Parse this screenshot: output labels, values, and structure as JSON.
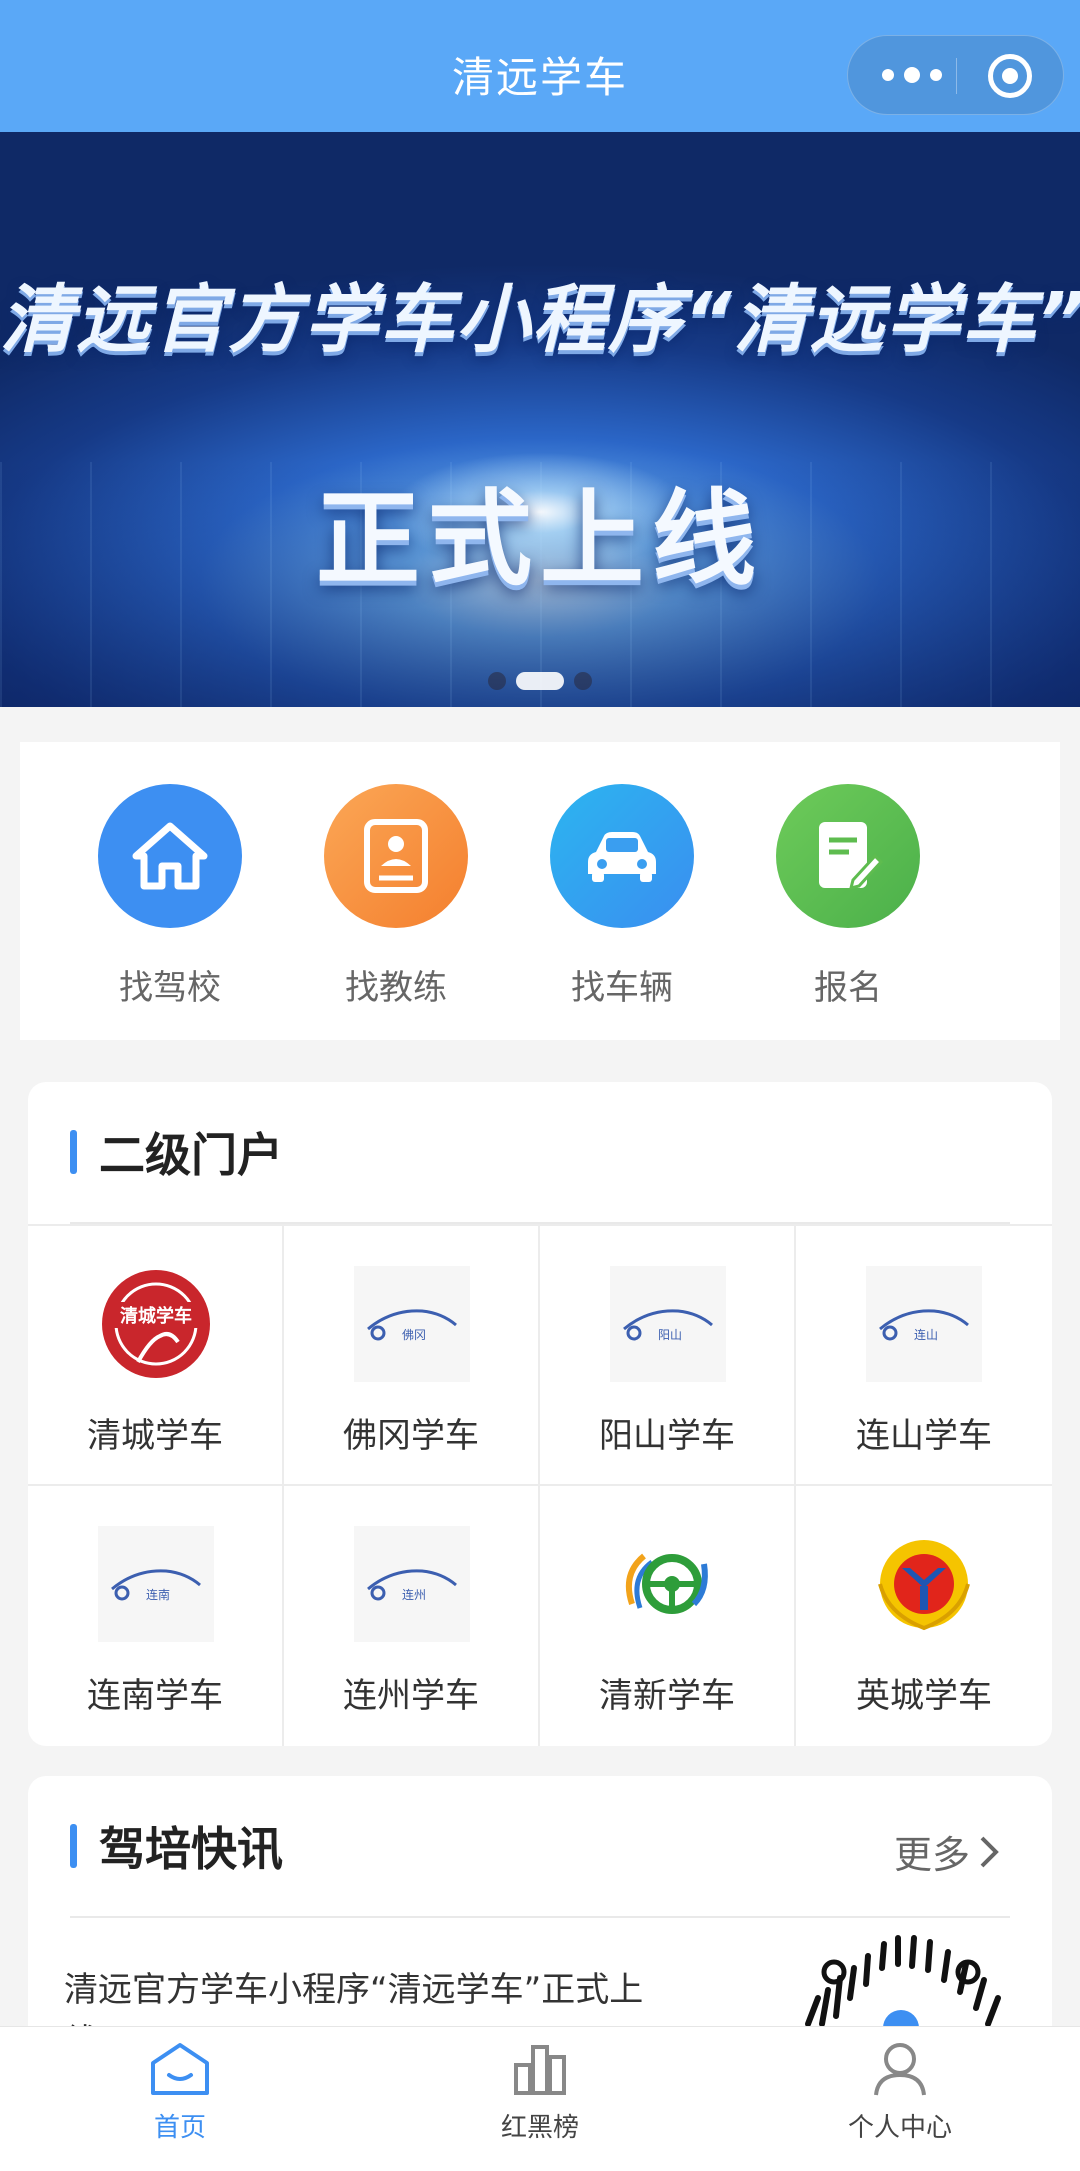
{
  "header": {
    "title": "清远学车"
  },
  "banner": {
    "headline": "清远官方学车小程序“清远学车”",
    "subline": "正式上线",
    "slide_count": 3,
    "active_slide": 2
  },
  "quick_menu": [
    {
      "label": "找驾校",
      "icon": "home-icon",
      "color": "#3d8ff2"
    },
    {
      "label": "找教练",
      "icon": "id-card-icon",
      "color": "#f7903c"
    },
    {
      "label": "找车辆",
      "icon": "car-icon",
      "color": "#36a3f2"
    },
    {
      "label": "报名",
      "icon": "form-edit-icon",
      "color": "#5ebc4f"
    }
  ],
  "portal": {
    "title": "二级门户",
    "items": [
      {
        "name": "清城学车",
        "logo": "qingcheng-logo",
        "logo_text": "清城学车"
      },
      {
        "name": "佛冈学车",
        "logo": "fogang-car-logo",
        "logo_text": "佛冈"
      },
      {
        "name": "阳山学车",
        "logo": "yangshan-car-logo",
        "logo_text": "阳山"
      },
      {
        "name": "连山学车",
        "logo": "lianshan-car-logo",
        "logo_text": "连山"
      },
      {
        "name": "连南学车",
        "logo": "liannan-car-logo",
        "logo_text": "连南"
      },
      {
        "name": "连州学车",
        "logo": "lianzhou-car-logo",
        "logo_text": "连州"
      },
      {
        "name": "清新学车",
        "logo": "qingxin-wheel-logo",
        "logo_text": ""
      },
      {
        "name": "英城学车",
        "logo": "yingcheng-emblem-logo",
        "logo_text": ""
      }
    ]
  },
  "news": {
    "title": "驾培快讯",
    "more_label": "更多",
    "item_text": "清远官方学车小程序“清远学车”正式上线！"
  },
  "tabbar": [
    {
      "label": "首页",
      "icon": "home-tab-icon",
      "active": true
    },
    {
      "label": "红黑榜",
      "icon": "ranking-icon",
      "active": false
    },
    {
      "label": "个人中心",
      "icon": "user-icon",
      "active": false
    }
  ],
  "colors": {
    "header_bg": "#5aa8f7",
    "accent": "#3d8ff2"
  }
}
